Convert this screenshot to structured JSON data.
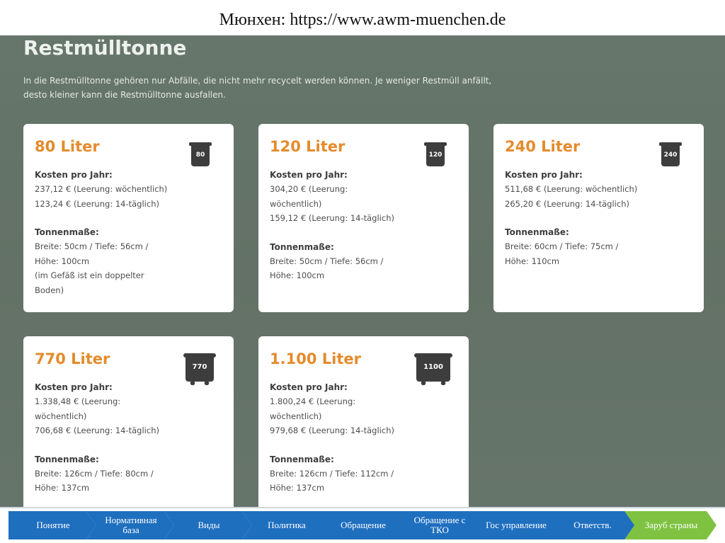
{
  "header": {
    "title": "Мюнхен: https://www.awm-muenchen.de"
  },
  "screenshot": {
    "title": "Restmülltonne",
    "intro": "In die Restmülltonne gehören nur Abfälle, die nicht mehr recycelt werden können. Je weniger Restmüll anfällt, desto kleiner kann die Restmülltonne ausfallen.",
    "cards": [
      {
        "title": "80 Liter",
        "bin_label": "80",
        "cost_label": "Kosten pro Jahr:",
        "cost_lines": [
          "237,12 € (Leerung: wöchentlich)",
          "123,24 € (Leerung: 14-täglich)"
        ],
        "dims_label": "Tonnenmaße:",
        "dims_lines": [
          "Breite: 50cm / Tiefe: 56cm /",
          "Höhe: 100cm",
          "(im Gefäß ist ein doppelter",
          "Boden)"
        ]
      },
      {
        "title": "120 Liter",
        "bin_label": "120",
        "cost_label": "Kosten pro Jahr:",
        "cost_lines": [
          "304,20 € (Leerung:",
          "wöchentlich)",
          "159,12 € (Leerung: 14-täglich)"
        ],
        "dims_label": "Tonnenmaße:",
        "dims_lines": [
          "Breite: 50cm / Tiefe: 56cm /",
          "Höhe: 100cm"
        ]
      },
      {
        "title": "240 Liter",
        "bin_label": "240",
        "cost_label": "Kosten pro Jahr:",
        "cost_lines": [
          "511,68 € (Leerung: wöchentlich)",
          "265,20 € (Leerung: 14-täglich)"
        ],
        "dims_label": "Tonnenmaße:",
        "dims_lines": [
          "Breite: 60cm / Tiefe: 75cm /",
          "Höhe: 110cm"
        ]
      },
      {
        "title": "770 Liter",
        "bin_label": "770",
        "cost_label": "Kosten pro Jahr:",
        "cost_lines": [
          "1.338,48 € (Leerung:",
          "wöchentlich)",
          "706,68 € (Leerung: 14-täglich)"
        ],
        "dims_label": "Tonnenmaße:",
        "dims_lines": [
          "Breite: 126cm / Tiefe: 80cm /",
          "Höhe: 137cm"
        ]
      },
      {
        "title": "1.100 Liter",
        "bin_label": "1100",
        "cost_label": "Kosten pro Jahr:",
        "cost_lines": [
          "1.800,24 € (Leerung:",
          "wöchentlich)",
          "979,68 € (Leerung: 14-täglich)"
        ],
        "dims_label": "Tonnenmaße:",
        "dims_lines": [
          "Breite: 126cm / Tiefe: 112cm /",
          "Höhe: 137cm"
        ]
      }
    ]
  },
  "nav": {
    "items": [
      {
        "label": "Понятие"
      },
      {
        "label": "Нормативная база"
      },
      {
        "label": "Виды"
      },
      {
        "label": "Политика"
      },
      {
        "label": "Обращение"
      },
      {
        "label": "Обращение с ТКО"
      },
      {
        "label": "Гос управление"
      },
      {
        "label": "Ответств."
      },
      {
        "label": "Заруб страны"
      }
    ],
    "active_color": "#7fc241",
    "default_color": "#1f6fbf"
  }
}
